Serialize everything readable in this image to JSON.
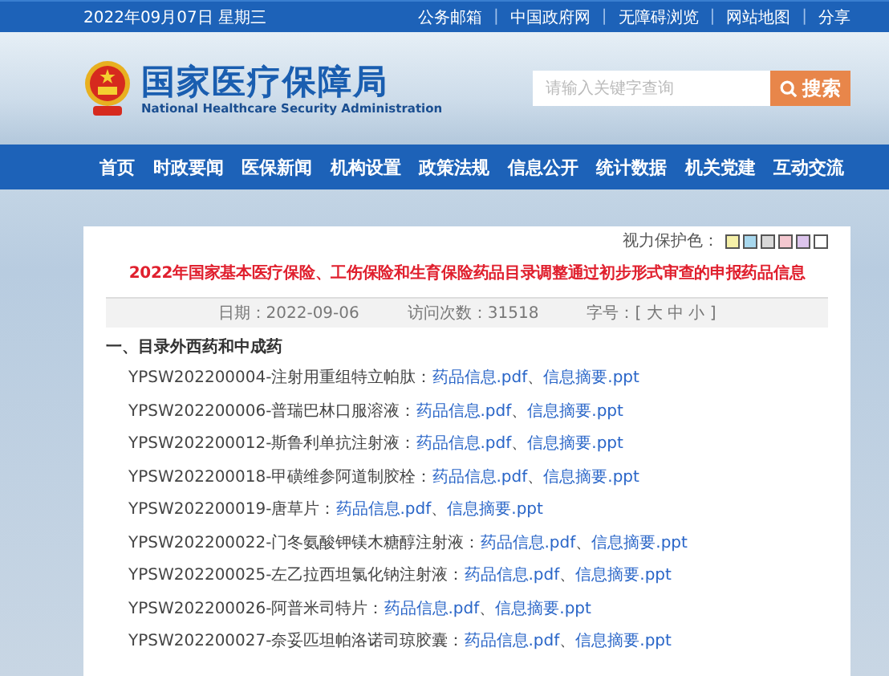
{
  "top_bar": {
    "date": "2022年09月07日 星期三",
    "links": [
      {
        "kind": "link",
        "text": "公务邮箱"
      },
      {
        "kind": "separator",
        "text": "|"
      },
      {
        "kind": "link",
        "text": "中国政府网"
      },
      {
        "kind": "separator",
        "text": "|"
      },
      {
        "kind": "link",
        "text": "无障碍浏览"
      },
      {
        "kind": "separator",
        "text": "|"
      },
      {
        "kind": "link",
        "text": "网站地图"
      },
      {
        "kind": "separator",
        "text": "|"
      },
      {
        "kind": "link",
        "text": "分享"
      }
    ]
  },
  "header": {
    "title": "国家医疗保障局",
    "subtitle": "National Healthcare Security Administration",
    "search": {
      "placeholder": "请输入关键字查询",
      "button": "搜索"
    }
  },
  "nav": [
    "首页",
    "时政要闻",
    "医保新闻",
    "机构设置",
    "政策法规",
    "信息公开",
    "统计数据",
    "机关党建",
    "互动交流"
  ],
  "eye_care": {
    "label": "视力保护色：",
    "swatches": [
      {
        "color": "#f5f0a8"
      },
      {
        "color": "#a8d8ee"
      },
      {
        "color": "#d8d8d8"
      },
      {
        "color": "#f4c8d0"
      },
      {
        "color": "#dcc4ec"
      },
      {
        "color": "#ffffff"
      }
    ]
  },
  "article": {
    "title": "2022年国家基本医疗保险、工伤保险和生育保险药品目录调整通过初步形式审查的申报药品信息",
    "meta": [
      "日期：2022-09-06",
      "访问次数：31518",
      "字号：[ 大 中 小 ]"
    ],
    "section": "一、目录外西药和中成药",
    "items": [
      {
        "label": "YPSW202200004-注射用重组特立帕肽：",
        "link1": "药品信息.pdf",
        "sep": "、",
        "link2": "信息摘要.ppt"
      },
      {
        "label": "YPSW202200006-普瑞巴林口服溶液：",
        "link1": "药品信息.pdf",
        "sep": "、",
        "link2": "信息摘要.ppt"
      },
      {
        "label": "YPSW202200012-斯鲁利单抗注射液：",
        "link1": "药品信息.pdf",
        "sep": "、",
        "link2": "信息摘要.ppt"
      },
      {
        "label": "YPSW202200018-甲磺维参阿道制胶栓：",
        "link1": "药品信息.pdf",
        "sep": "、",
        "link2": "信息摘要.ppt"
      },
      {
        "label": "YPSW202200019-唐草片：",
        "link1": "药品信息.pdf",
        "sep": "、",
        "link2": "信息摘要.ppt"
      },
      {
        "label": "YPSW202200022-门冬氨酸钾镁木糖醇注射液：",
        "link1": "药品信息.pdf",
        "sep": "、",
        "link2": "信息摘要.ppt"
      },
      {
        "label": "YPSW202200025-左乙拉西坦氯化钠注射液：",
        "link1": "药品信息.pdf",
        "sep": "、",
        "link2": "信息摘要.ppt"
      },
      {
        "label": "YPSW202200026-阿普米司特片：",
        "link1": "药品信息.pdf",
        "sep": "、",
        "link2": "信息摘要.ppt"
      },
      {
        "label": "YPSW202200027-奈妥匹坦帕洛诺司琼胶囊：",
        "link1": "药品信息.pdf",
        "sep": "、",
        "link2": "信息摘要.ppt"
      }
    ]
  }
}
